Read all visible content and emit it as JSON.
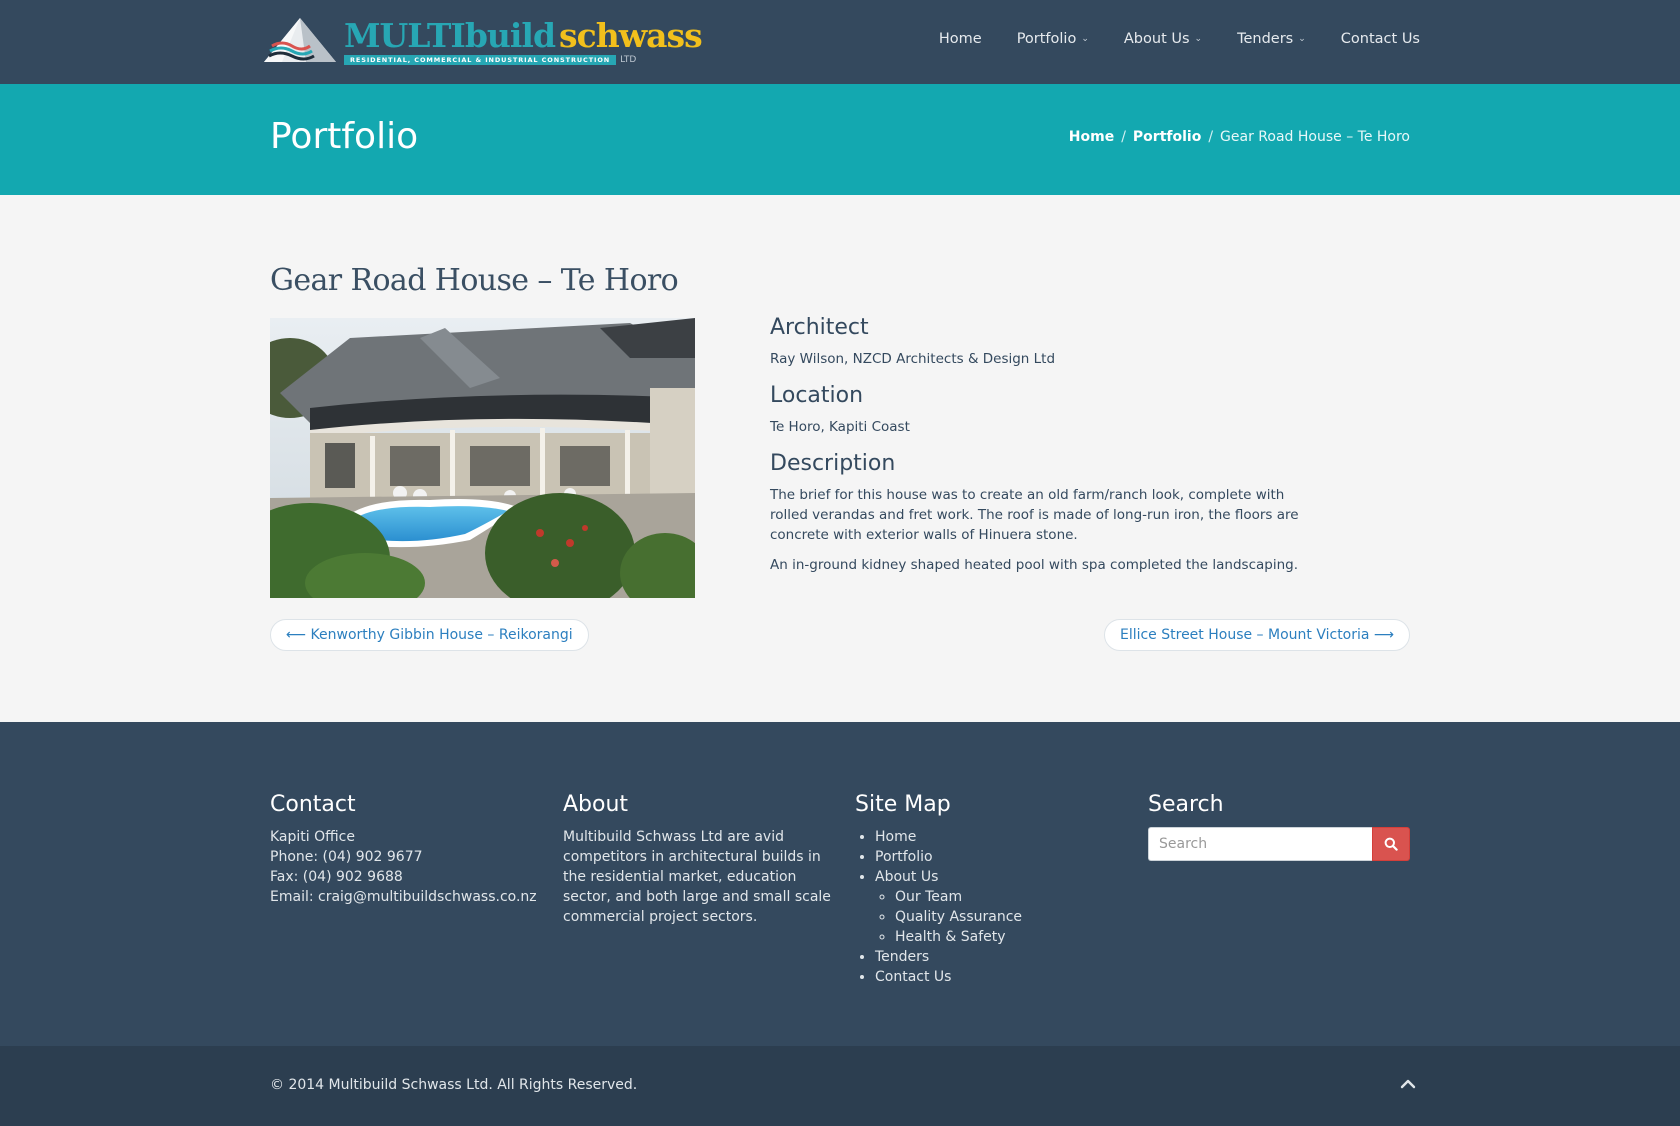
{
  "brand": {
    "name_part1": "MULTIbuild",
    "name_part2": "schwass",
    "tagline": "RESIDENTIAL, COMMERCIAL & INDUSTRIAL CONSTRUCTION",
    "suffix": "LTD"
  },
  "nav": {
    "items": [
      {
        "label": "Home",
        "has_dropdown": false
      },
      {
        "label": "Portfolio",
        "has_dropdown": true
      },
      {
        "label": "About Us",
        "has_dropdown": true
      },
      {
        "label": "Tenders",
        "has_dropdown": true
      },
      {
        "label": "Contact Us",
        "has_dropdown": false
      }
    ]
  },
  "titlebar": {
    "title": "Portfolio",
    "breadcrumb": {
      "home": "Home",
      "section": "Portfolio",
      "current": "Gear Road House – Te Horo"
    }
  },
  "post": {
    "title": "Gear Road House – Te Horo",
    "architect_heading": "Architect",
    "architect": "Ray Wilson, NZCD Architects & Design Ltd",
    "location_heading": "Location",
    "location": "Te Horo, Kapiti Coast",
    "description_heading": "Description",
    "description_p1": "The brief for this house was to create an old farm/ranch look, complete with rolled verandas and fret work. The roof is made of long-run iron, the floors are concrete with exterior walls of Hinuera stone.",
    "description_p2": "An in-ground kidney shaped heated pool with spa completed the landscaping.",
    "prev_link": "⟵ Kenworthy Gibbin House – Reikorangi",
    "next_link": "Ellice Street House – Mount Victoria ⟶"
  },
  "footer": {
    "contact": {
      "heading": "Contact",
      "office": "Kapiti Office",
      "phone": "Phone: (04) 902 9677",
      "fax": "Fax: (04) 902 9688",
      "email": "Email: craig@multibuildschwass.co.nz"
    },
    "about": {
      "heading": "About",
      "text": "Multibuild Schwass Ltd are avid competitors in architectural builds in the residential market, education sector, and both large and small scale commercial project sectors."
    },
    "sitemap": {
      "heading": "Site Map",
      "home": "Home",
      "portfolio": "Portfolio",
      "about": "About Us",
      "our_team": "Our Team",
      "quality": "Quality Assurance",
      "health": "Health & Safety",
      "tenders": "Tenders",
      "contact": "Contact Us"
    },
    "search": {
      "heading": "Search",
      "placeholder": "Search"
    },
    "copyright": "© 2014 Multibuild Schwass Ltd. All Rights Reserved."
  },
  "colors": {
    "header_bg": "#34495e",
    "accent_teal": "#13a8b0",
    "search_button": "#d9534f",
    "link_blue": "#2c7fbf"
  },
  "icons": [
    "logo-pyramid-icon",
    "chevron-down-icon",
    "search-icon",
    "chevron-up-icon"
  ]
}
